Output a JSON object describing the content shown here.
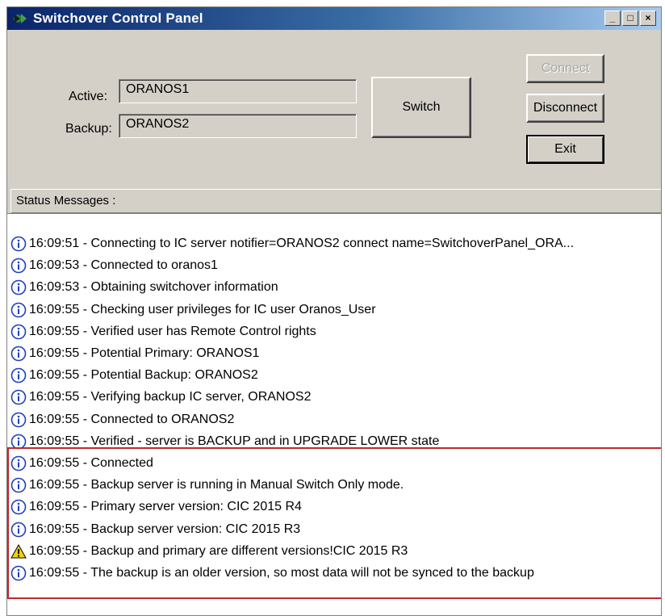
{
  "window": {
    "title": "Switchover Control Panel",
    "minimize_glyph": "_",
    "maximize_glyph": "□",
    "close_glyph": "×"
  },
  "servers": {
    "active_label": "Active:",
    "active_value": "ORANOS1",
    "backup_label": "Backup:",
    "backup_value": "ORANOS2"
  },
  "buttons": {
    "switch": "Switch",
    "connect": "Connect",
    "disconnect": "Disconnect",
    "exit": "Exit"
  },
  "status": {
    "header": "Status Messages :",
    "messages": [
      {
        "icon": "info-icon",
        "text": "16:09:51 - Connecting to IC server notifier=ORANOS2 connect name=SwitchoverPanel_ORA..."
      },
      {
        "icon": "info-icon",
        "text": "16:09:53 - Connected to oranos1"
      },
      {
        "icon": "info-icon",
        "text": "16:09:53 - Obtaining switchover information"
      },
      {
        "icon": "info-icon",
        "text": "16:09:55 - Checking user privileges for IC user Oranos_User"
      },
      {
        "icon": "info-icon",
        "text": "16:09:55 - Verified user has Remote Control rights"
      },
      {
        "icon": "info-icon",
        "text": "16:09:55 - Potential Primary:  ORANOS1"
      },
      {
        "icon": "info-icon",
        "text": "16:09:55 - Potential Backup:  ORANOS2"
      },
      {
        "icon": "info-icon",
        "text": "16:09:55 - Verifying backup IC server, ORANOS2"
      },
      {
        "icon": "info-icon",
        "text": "16:09:55 - Connected to ORANOS2"
      },
      {
        "icon": "info-icon",
        "text": "16:09:55 - Verified - server is BACKUP and in UPGRADE LOWER state"
      },
      {
        "icon": "info-icon",
        "text": "16:09:55 - Connected"
      },
      {
        "icon": "info-icon",
        "text": "16:09:55 - Backup server is running in Manual Switch Only mode."
      },
      {
        "icon": "info-icon",
        "text": "16:09:55 - Primary server version: CIC 2015 R4"
      },
      {
        "icon": "info-icon",
        "text": "16:09:55 - Backup server version: CIC 2015 R3"
      },
      {
        "icon": "warning-icon",
        "text": "16:09:55 - Backup and primary are different versions!CIC 2015 R3"
      },
      {
        "icon": "info-icon",
        "text": "16:09:55 - The backup is an older version, so most data will not be synced to the backup"
      }
    ]
  },
  "colors": {
    "highlight": "#c0282d",
    "info_icon": "#1f3fbf",
    "warning_icon": "#f2d20a"
  }
}
